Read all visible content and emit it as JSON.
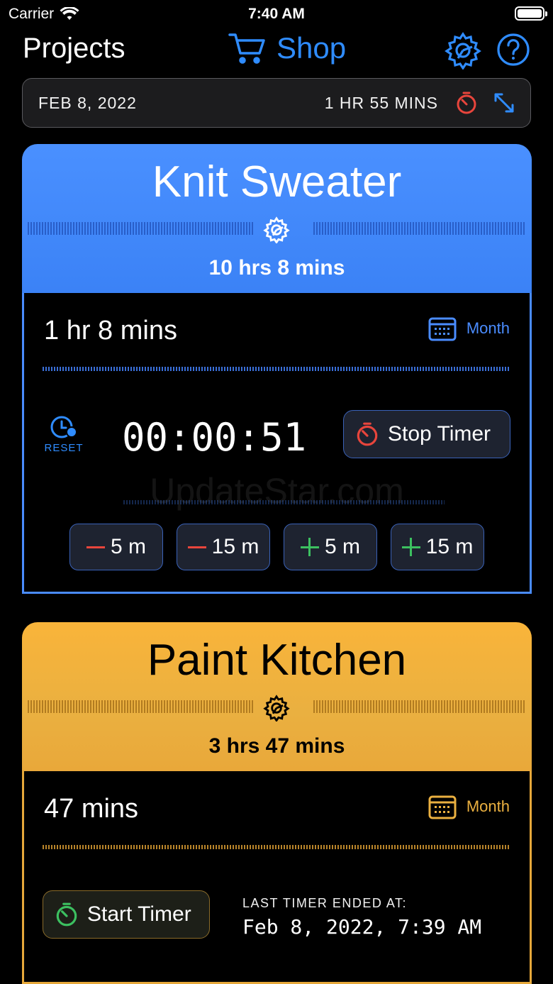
{
  "status_bar": {
    "carrier": "Carrier",
    "time": "7:40 AM"
  },
  "nav": {
    "title": "Projects",
    "shop_label": "Shop"
  },
  "summary": {
    "date": "FEB 8, 2022",
    "total": "1 HR  55 MINS"
  },
  "projects": [
    {
      "name": "Knit Sweater",
      "total": "10 hrs  8 mins",
      "period_time": "1 hr  8 mins",
      "period_label": "Month",
      "reset_label": "RESET",
      "clock": "00:00:51",
      "timer_button": "Stop Timer",
      "adjust": [
        "5 m",
        "15 m",
        "5 m",
        "15 m"
      ],
      "color": "#4a90ff"
    },
    {
      "name": "Paint Kitchen",
      "total": "3 hrs  47 mins",
      "period_time": "47 mins",
      "period_label": "Month",
      "timer_button": "Start Timer",
      "last_label": "LAST TIMER ENDED AT:",
      "last_value": "Feb 8, 2022, 7:39 AM",
      "color": "#f2b03a"
    }
  ],
  "watermark": "UpdateStar.com",
  "icons": {
    "wifi": "wifi-icon",
    "battery": "battery-icon",
    "cart": "cart-icon",
    "settings": "gear-icon",
    "help": "question-icon",
    "stopwatch": "stopwatch-icon",
    "expand": "expand-icon",
    "calendar": "calendar-icon",
    "reset": "clock-reset-icon"
  }
}
